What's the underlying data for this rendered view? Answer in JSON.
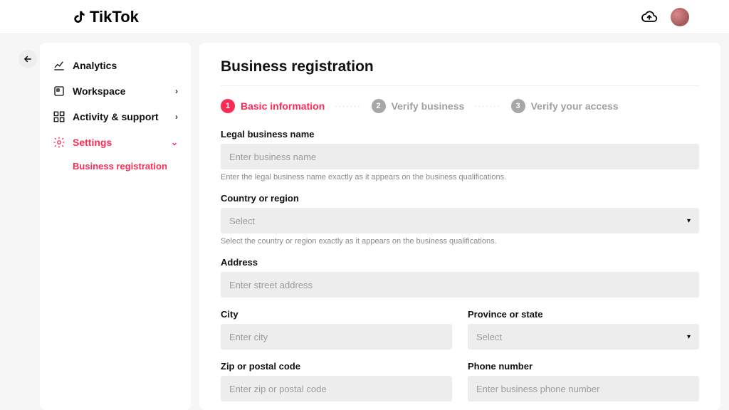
{
  "brand": "TikTok",
  "sidebar": {
    "items": [
      {
        "label": "Analytics",
        "icon": "analytics"
      },
      {
        "label": "Workspace",
        "icon": "workspace",
        "expandable": true
      },
      {
        "label": "Activity & support",
        "icon": "activity",
        "expandable": true
      },
      {
        "label": "Settings",
        "icon": "settings",
        "expandable": true,
        "active": true
      }
    ],
    "subitem": "Business registration"
  },
  "page": {
    "title": "Business registration",
    "steps": [
      {
        "num": "1",
        "label": "Basic information"
      },
      {
        "num": "2",
        "label": "Verify business"
      },
      {
        "num": "3",
        "label": "Verify your access"
      }
    ],
    "fields": {
      "legal_name": {
        "label": "Legal business name",
        "placeholder": "Enter business name",
        "hint": "Enter the legal business name exactly as it appears on the business qualifications."
      },
      "country": {
        "label": "Country or region",
        "placeholder": "Select",
        "hint": "Select the country or region exactly as it appears on the business qualifications."
      },
      "address": {
        "label": "Address",
        "placeholder": "Enter street address"
      },
      "city": {
        "label": "City",
        "placeholder": "Enter city"
      },
      "province": {
        "label": "Province or state",
        "placeholder": "Select"
      },
      "zip": {
        "label": "Zip or postal code",
        "placeholder": "Enter zip or postal code"
      },
      "phone": {
        "label": "Phone number",
        "placeholder": "Enter business phone number"
      }
    }
  }
}
